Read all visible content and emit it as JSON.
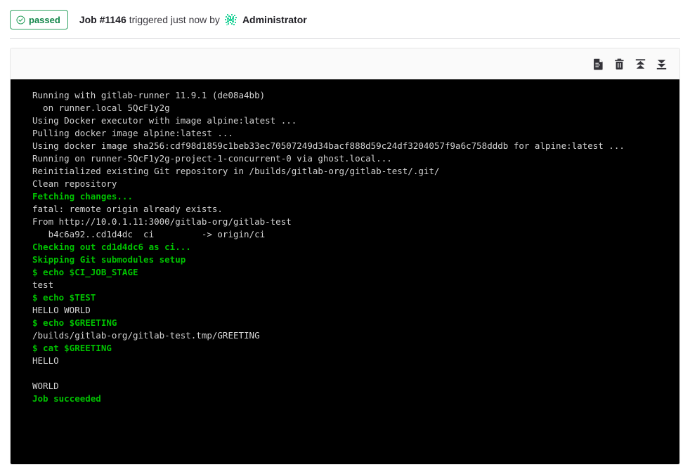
{
  "header": {
    "status_badge": {
      "label": "passed",
      "icon": "check-circle-icon",
      "color": "#108548",
      "border_color": "#2da160"
    },
    "job_label": "Job #1146",
    "triggered_text": "triggered just now by",
    "avatar": "user-identicon-avatar",
    "user_name": "Administrator"
  },
  "toolbar": {
    "buttons": [
      {
        "name": "show-raw-button",
        "icon": "document-icon",
        "title": "Show complete raw"
      },
      {
        "name": "erase-log-button",
        "icon": "trash-icon",
        "title": "Erase job log"
      },
      {
        "name": "scroll-to-top-button",
        "icon": "scroll-up-icon",
        "title": "Scroll to top"
      },
      {
        "name": "scroll-to-bottom-button",
        "icon": "scroll-down-icon",
        "title": "Scroll to bottom"
      }
    ]
  },
  "log": {
    "colors": {
      "background": "#000000",
      "text": "#d3d3d3",
      "highlight": "#00c200"
    },
    "lines": [
      {
        "text": "Running with gitlab-runner 11.9.1 (de08a4bb)",
        "style": "plain"
      },
      {
        "text": "  on runner.local 5QcF1y2g",
        "style": "plain"
      },
      {
        "text": "Using Docker executor with image alpine:latest ...",
        "style": "plain"
      },
      {
        "text": "Pulling docker image alpine:latest ...",
        "style": "plain"
      },
      {
        "text": "Using docker image sha256:cdf98d1859c1beb33ec70507249d34bacf888d59c24df3204057f9a6c758dddb for alpine:latest ...",
        "style": "plain"
      },
      {
        "text": "Running on runner-5QcF1y2g-project-1-concurrent-0 via ghost.local...",
        "style": "plain"
      },
      {
        "text": "Reinitialized existing Git repository in /builds/gitlab-org/gitlab-test/.git/",
        "style": "plain"
      },
      {
        "text": "Clean repository",
        "style": "plain"
      },
      {
        "text": "Fetching changes...",
        "style": "green"
      },
      {
        "text": "fatal: remote origin already exists.",
        "style": "plain"
      },
      {
        "text": "From http://10.0.1.11:3000/gitlab-org/gitlab-test",
        "style": "plain"
      },
      {
        "text": "   b4c6a92..cd1d4dc  ci         -> origin/ci",
        "style": "plain"
      },
      {
        "text": "Checking out cd1d4dc6 as ci...",
        "style": "green"
      },
      {
        "text": "Skipping Git submodules setup",
        "style": "green"
      },
      {
        "text": "$ echo $CI_JOB_STAGE",
        "style": "green"
      },
      {
        "text": "test",
        "style": "plain"
      },
      {
        "text": "$ echo $TEST",
        "style": "green"
      },
      {
        "text": "HELLO WORLD",
        "style": "plain"
      },
      {
        "text": "$ echo $GREETING",
        "style": "green"
      },
      {
        "text": "/builds/gitlab-org/gitlab-test.tmp/GREETING",
        "style": "plain"
      },
      {
        "text": "$ cat $GREETING",
        "style": "green"
      },
      {
        "text": "HELLO",
        "style": "plain"
      },
      {
        "text": "",
        "style": "plain"
      },
      {
        "text": "WORLD",
        "style": "plain"
      },
      {
        "text": "Job succeeded",
        "style": "green"
      }
    ]
  }
}
